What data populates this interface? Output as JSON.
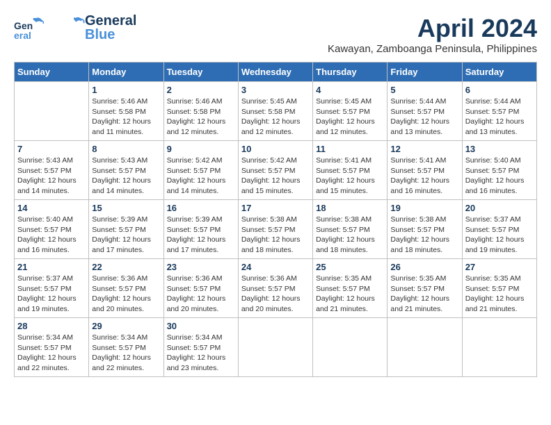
{
  "header": {
    "logo_line1": "General",
    "logo_line2": "Blue",
    "month_title": "April 2024",
    "location": "Kawayan, Zamboanga Peninsula, Philippines"
  },
  "days_of_week": [
    "Sunday",
    "Monday",
    "Tuesday",
    "Wednesday",
    "Thursday",
    "Friday",
    "Saturday"
  ],
  "weeks": [
    [
      {
        "day": "",
        "info": ""
      },
      {
        "day": "1",
        "info": "Sunrise: 5:46 AM\nSunset: 5:58 PM\nDaylight: 12 hours\nand 11 minutes."
      },
      {
        "day": "2",
        "info": "Sunrise: 5:46 AM\nSunset: 5:58 PM\nDaylight: 12 hours\nand 12 minutes."
      },
      {
        "day": "3",
        "info": "Sunrise: 5:45 AM\nSunset: 5:58 PM\nDaylight: 12 hours\nand 12 minutes."
      },
      {
        "day": "4",
        "info": "Sunrise: 5:45 AM\nSunset: 5:57 PM\nDaylight: 12 hours\nand 12 minutes."
      },
      {
        "day": "5",
        "info": "Sunrise: 5:44 AM\nSunset: 5:57 PM\nDaylight: 12 hours\nand 13 minutes."
      },
      {
        "day": "6",
        "info": "Sunrise: 5:44 AM\nSunset: 5:57 PM\nDaylight: 12 hours\nand 13 minutes."
      }
    ],
    [
      {
        "day": "7",
        "info": "Sunrise: 5:43 AM\nSunset: 5:57 PM\nDaylight: 12 hours\nand 14 minutes."
      },
      {
        "day": "8",
        "info": "Sunrise: 5:43 AM\nSunset: 5:57 PM\nDaylight: 12 hours\nand 14 minutes."
      },
      {
        "day": "9",
        "info": "Sunrise: 5:42 AM\nSunset: 5:57 PM\nDaylight: 12 hours\nand 14 minutes."
      },
      {
        "day": "10",
        "info": "Sunrise: 5:42 AM\nSunset: 5:57 PM\nDaylight: 12 hours\nand 15 minutes."
      },
      {
        "day": "11",
        "info": "Sunrise: 5:41 AM\nSunset: 5:57 PM\nDaylight: 12 hours\nand 15 minutes."
      },
      {
        "day": "12",
        "info": "Sunrise: 5:41 AM\nSunset: 5:57 PM\nDaylight: 12 hours\nand 16 minutes."
      },
      {
        "day": "13",
        "info": "Sunrise: 5:40 AM\nSunset: 5:57 PM\nDaylight: 12 hours\nand 16 minutes."
      }
    ],
    [
      {
        "day": "14",
        "info": "Sunrise: 5:40 AM\nSunset: 5:57 PM\nDaylight: 12 hours\nand 16 minutes."
      },
      {
        "day": "15",
        "info": "Sunrise: 5:39 AM\nSunset: 5:57 PM\nDaylight: 12 hours\nand 17 minutes."
      },
      {
        "day": "16",
        "info": "Sunrise: 5:39 AM\nSunset: 5:57 PM\nDaylight: 12 hours\nand 17 minutes."
      },
      {
        "day": "17",
        "info": "Sunrise: 5:38 AM\nSunset: 5:57 PM\nDaylight: 12 hours\nand 18 minutes."
      },
      {
        "day": "18",
        "info": "Sunrise: 5:38 AM\nSunset: 5:57 PM\nDaylight: 12 hours\nand 18 minutes."
      },
      {
        "day": "19",
        "info": "Sunrise: 5:38 AM\nSunset: 5:57 PM\nDaylight: 12 hours\nand 18 minutes."
      },
      {
        "day": "20",
        "info": "Sunrise: 5:37 AM\nSunset: 5:57 PM\nDaylight: 12 hours\nand 19 minutes."
      }
    ],
    [
      {
        "day": "21",
        "info": "Sunrise: 5:37 AM\nSunset: 5:57 PM\nDaylight: 12 hours\nand 19 minutes."
      },
      {
        "day": "22",
        "info": "Sunrise: 5:36 AM\nSunset: 5:57 PM\nDaylight: 12 hours\nand 20 minutes."
      },
      {
        "day": "23",
        "info": "Sunrise: 5:36 AM\nSunset: 5:57 PM\nDaylight: 12 hours\nand 20 minutes."
      },
      {
        "day": "24",
        "info": "Sunrise: 5:36 AM\nSunset: 5:57 PM\nDaylight: 12 hours\nand 20 minutes."
      },
      {
        "day": "25",
        "info": "Sunrise: 5:35 AM\nSunset: 5:57 PM\nDaylight: 12 hours\nand 21 minutes."
      },
      {
        "day": "26",
        "info": "Sunrise: 5:35 AM\nSunset: 5:57 PM\nDaylight: 12 hours\nand 21 minutes."
      },
      {
        "day": "27",
        "info": "Sunrise: 5:35 AM\nSunset: 5:57 PM\nDaylight: 12 hours\nand 21 minutes."
      }
    ],
    [
      {
        "day": "28",
        "info": "Sunrise: 5:34 AM\nSunset: 5:57 PM\nDaylight: 12 hours\nand 22 minutes."
      },
      {
        "day": "29",
        "info": "Sunrise: 5:34 AM\nSunset: 5:57 PM\nDaylight: 12 hours\nand 22 minutes."
      },
      {
        "day": "30",
        "info": "Sunrise: 5:34 AM\nSunset: 5:57 PM\nDaylight: 12 hours\nand 23 minutes."
      },
      {
        "day": "",
        "info": ""
      },
      {
        "day": "",
        "info": ""
      },
      {
        "day": "",
        "info": ""
      },
      {
        "day": "",
        "info": ""
      }
    ]
  ]
}
